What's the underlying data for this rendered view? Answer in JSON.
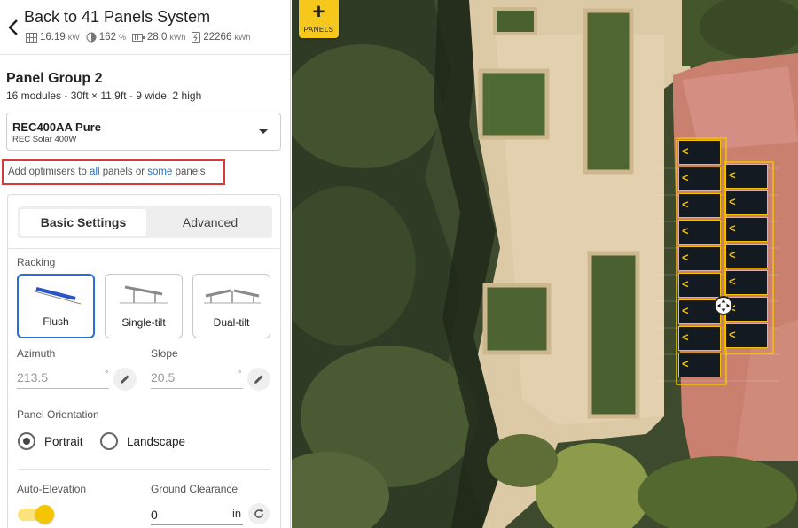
{
  "header": {
    "title": "Back to 41 Panels System",
    "stats": [
      {
        "icon": "panel-grid-icon",
        "value": "16.19",
        "unit": "kW"
      },
      {
        "icon": "sun-moon-icon",
        "value": "162",
        "unit": "%"
      },
      {
        "icon": "battery-icon",
        "value": "28.0",
        "unit": "kWh"
      },
      {
        "icon": "lightning-icon",
        "value": "22266",
        "unit": "kWh"
      }
    ]
  },
  "group": {
    "title": "Panel Group 2",
    "subtitle": "16 modules - 30ft × 11.9ft - 9 wide, 2 high"
  },
  "panel_select": {
    "name": "REC400AA Pure",
    "sub": "REC Solar 400W"
  },
  "optimiser": {
    "prefix": "Add optimisers to ",
    "all": "all",
    "middle": " panels or ",
    "some": "some",
    "suffix": " panels"
  },
  "tabs": [
    {
      "label": "Basic Settings",
      "active": true
    },
    {
      "label": "Advanced",
      "active": false
    }
  ],
  "racking": {
    "label": "Racking",
    "options": [
      {
        "label": "Flush",
        "selected": true
      },
      {
        "label": "Single-tilt",
        "selected": false
      },
      {
        "label": "Dual-tilt",
        "selected": false
      }
    ]
  },
  "azimuth": {
    "label": "Azimuth",
    "value": "213.5",
    "unit": "°"
  },
  "slope": {
    "label": "Slope",
    "value": "20.5",
    "unit": "°"
  },
  "orientation": {
    "label": "Panel Orientation",
    "options": [
      {
        "label": "Portrait",
        "selected": true
      },
      {
        "label": "Landscape",
        "selected": false
      }
    ]
  },
  "auto_elevation": {
    "label": "Auto-Elevation",
    "enabled": true
  },
  "ground_clearance": {
    "label": "Ground Clearance",
    "value": "0",
    "unit": "in"
  },
  "map": {
    "add_button": {
      "symbol": "+",
      "label": "PANELS"
    },
    "panel_chevron": "<",
    "panel_color": "#141a22",
    "panel_border_color": "#f4c200"
  },
  "colors": {
    "accent": "#f7c81c",
    "link": "#1a6fd1",
    "highlight_border": "#d63a3a",
    "selected_border": "#2a6fd6"
  }
}
